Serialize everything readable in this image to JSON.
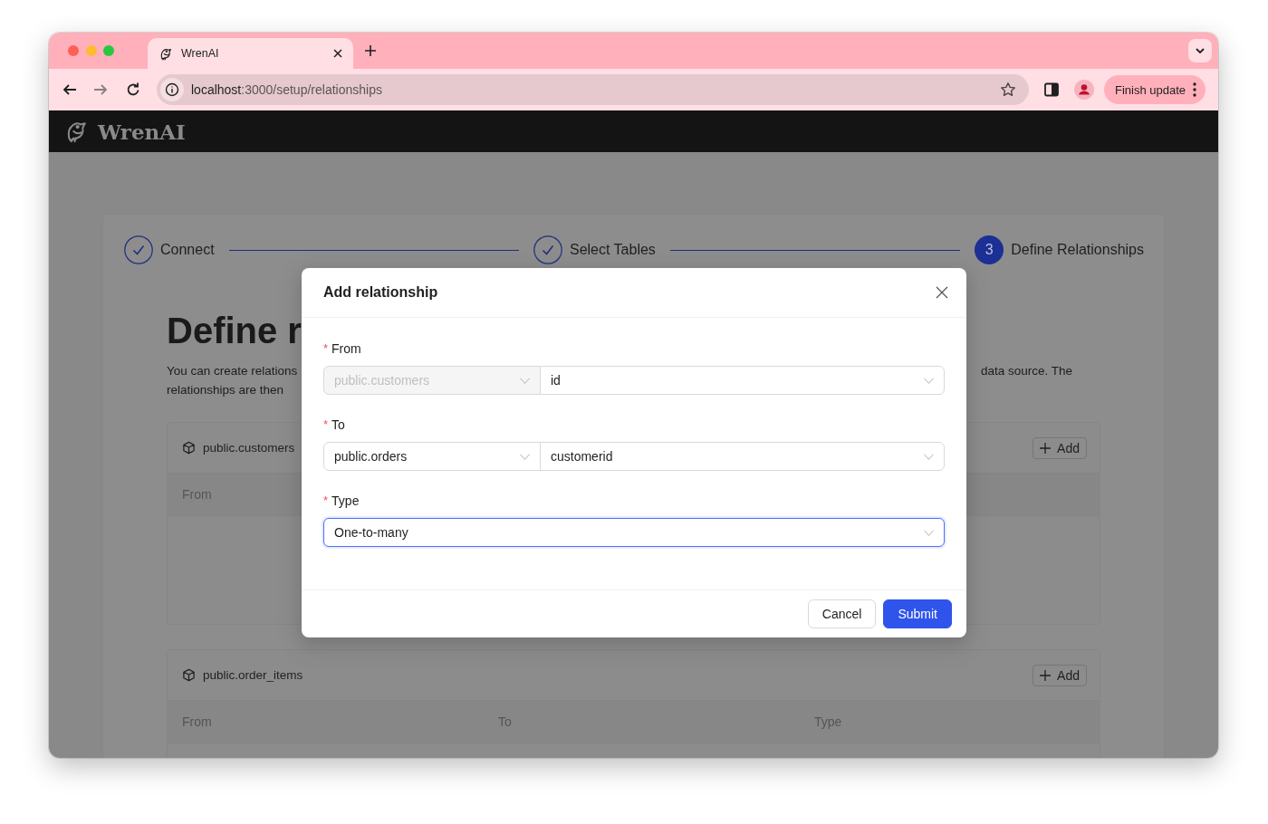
{
  "browser": {
    "tabs": [
      {
        "title": "WrenAI",
        "selected": true
      }
    ],
    "url": {
      "host": "localhost",
      "path": ":3000/setup/relationships"
    },
    "update_button": "Finish update"
  },
  "app_header": {
    "brand": "WrenAI"
  },
  "steps": [
    {
      "label": "Connect",
      "completed": true
    },
    {
      "label": "Select Tables",
      "completed": true
    },
    {
      "label": "Define Relationships",
      "completed": false,
      "number": "3"
    }
  ],
  "page": {
    "heading": "Define r",
    "description": [
      {
        "left": "You can create relations",
        "right": "data source. The"
      },
      {
        "left": "relationships are then"
      }
    ]
  },
  "models": [
    {
      "name": "public.customers",
      "add_button": "Add",
      "columns": [
        "From"
      ]
    },
    {
      "name": "public.order_items",
      "add_button": "Add",
      "columns": [
        "From",
        "To",
        "Type"
      ]
    }
  ],
  "dialog": {
    "title": "Add relationship",
    "fields": [
      {
        "label": "From",
        "required_mark": "*",
        "selects": [
          {
            "value": "public.customers",
            "disabled": true,
            "focused": false
          },
          {
            "value": "id",
            "disabled": false,
            "focused": false
          }
        ]
      },
      {
        "label": "To",
        "required_mark": "*",
        "selects": [
          {
            "value": "public.orders",
            "disabled": false,
            "focused": false
          },
          {
            "value": "customerid",
            "disabled": false,
            "focused": false
          }
        ]
      },
      {
        "label": "Type",
        "required_mark": "*",
        "selects": [
          {
            "value": "One-to-many",
            "disabled": false,
            "focused": true
          }
        ]
      }
    ],
    "buttons": [
      {
        "label": "Cancel",
        "kind": "default"
      },
      {
        "label": "Submit",
        "kind": "primary"
      }
    ]
  }
}
